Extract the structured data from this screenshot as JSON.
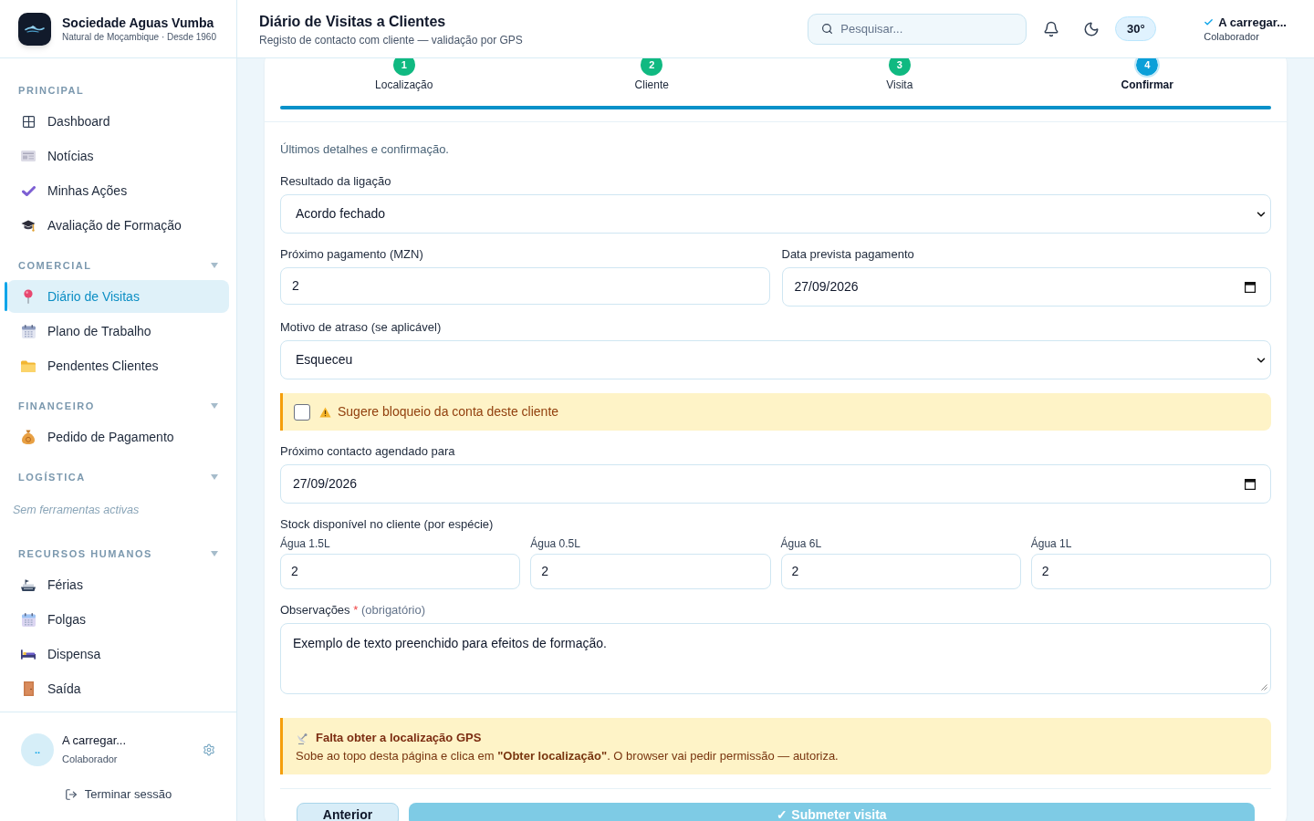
{
  "sidebar": {
    "brand": {
      "name": "Sociedade Aguas Vumba",
      "tagline": "Natural de Moçambique · Desde 1960"
    },
    "sections": [
      {
        "title": "PRINCIPAL",
        "collapsible": false,
        "items": [
          {
            "label": "Dashboard",
            "selected": false
          },
          {
            "label": "Notícias",
            "selected": false
          },
          {
            "label": "Minhas Ações",
            "selected": false
          },
          {
            "label": "Avaliação de Formação",
            "selected": false
          }
        ]
      },
      {
        "title": "COMERCIAL",
        "collapsible": true,
        "items": [
          {
            "label": "Diário de Visitas",
            "selected": true
          },
          {
            "label": "Plano de Trabalho",
            "selected": false
          },
          {
            "label": "Pendentes Clientes",
            "selected": false
          }
        ]
      },
      {
        "title": "FINANCEIRO",
        "collapsible": true,
        "items": [
          {
            "label": "Pedido de Pagamento",
            "selected": false
          }
        ]
      },
      {
        "title": "LOGÍSTICA",
        "collapsible": true,
        "note": "Sem ferramentas activas"
      },
      {
        "title": "RECURSOS HUMANOS",
        "collapsible": true,
        "items": [
          {
            "label": "Férias",
            "selected": false
          },
          {
            "label": "Folgas",
            "selected": false
          },
          {
            "label": "Dispensa",
            "selected": false
          },
          {
            "label": "Saída",
            "selected": false
          }
        ]
      }
    ],
    "user": {
      "avatar_text": "..",
      "name": "A carregar...",
      "role": "Colaborador"
    },
    "logout": "Terminar sessão"
  },
  "header": {
    "title": "Diário de Visitas a Clientes",
    "subtitle": "Registo de contacto com cliente — validação por GPS",
    "search": {
      "placeholder": "Pesquisar..."
    },
    "temperature": "30°",
    "status": {
      "text": "A carregar...",
      "role": "Colaborador"
    }
  },
  "stepper": {
    "steps": [
      {
        "number": "1",
        "label": "Localização",
        "done": true,
        "selected": false
      },
      {
        "number": "2",
        "label": "Cliente",
        "done": true,
        "selected": false
      },
      {
        "number": "3",
        "label": "Visita",
        "done": true,
        "selected": false
      },
      {
        "number": "4",
        "label": "Confirmar",
        "done": false,
        "selected": true
      }
    ],
    "level": 1
  },
  "form": {
    "intro": "Últimos detalhes e confirmação.",
    "rows": [
      {
        "kind": "select",
        "label": "Resultado da ligação",
        "value": "Acordo fechado"
      },
      {
        "kind": "pair",
        "fields": [
          {
            "kind": "text",
            "label": "Próximo pagamento (MZN)",
            "value": "2"
          },
          {
            "kind": "date",
            "label": "Data prevista pagamento",
            "value": "27/09/2026"
          }
        ]
      },
      {
        "kind": "select",
        "label": "Motivo de atraso (se aplicável)",
        "value": "Esqueceu"
      },
      {
        "kind": "checkbox",
        "label": "Sugere bloqueio da conta deste cliente",
        "checked": false
      },
      {
        "kind": "date",
        "label": "Próximo contacto agendado para",
        "value": "27/09/2026"
      },
      {
        "kind": "stock",
        "label": "Stock disponível no cliente (por espécie)",
        "fields": [
          {
            "label": "Água 1.5L",
            "value": "2"
          },
          {
            "label": "Água 0.5L",
            "value": "2"
          },
          {
            "label": "Água 6L",
            "value": "2"
          },
          {
            "label": "Água 1L",
            "value": "2"
          }
        ]
      },
      {
        "kind": "textarea",
        "label": "Observações",
        "required_mark": "*",
        "hint": "(obrigatório)",
        "value": "Exemplo de texto preenchido para efeitos de formação."
      }
    ]
  },
  "notice": {
    "title": "Falta obter a localização GPS",
    "text": "Sobe ao topo desta página e clica em **\"Obter localização\"**. O browser vai pedir permissão — autoriza."
  },
  "actions": [
    {
      "label": "Anterior",
      "kind": "secondary"
    },
    {
      "label": "✓ Submeter visita",
      "kind": "primary"
    }
  ]
}
